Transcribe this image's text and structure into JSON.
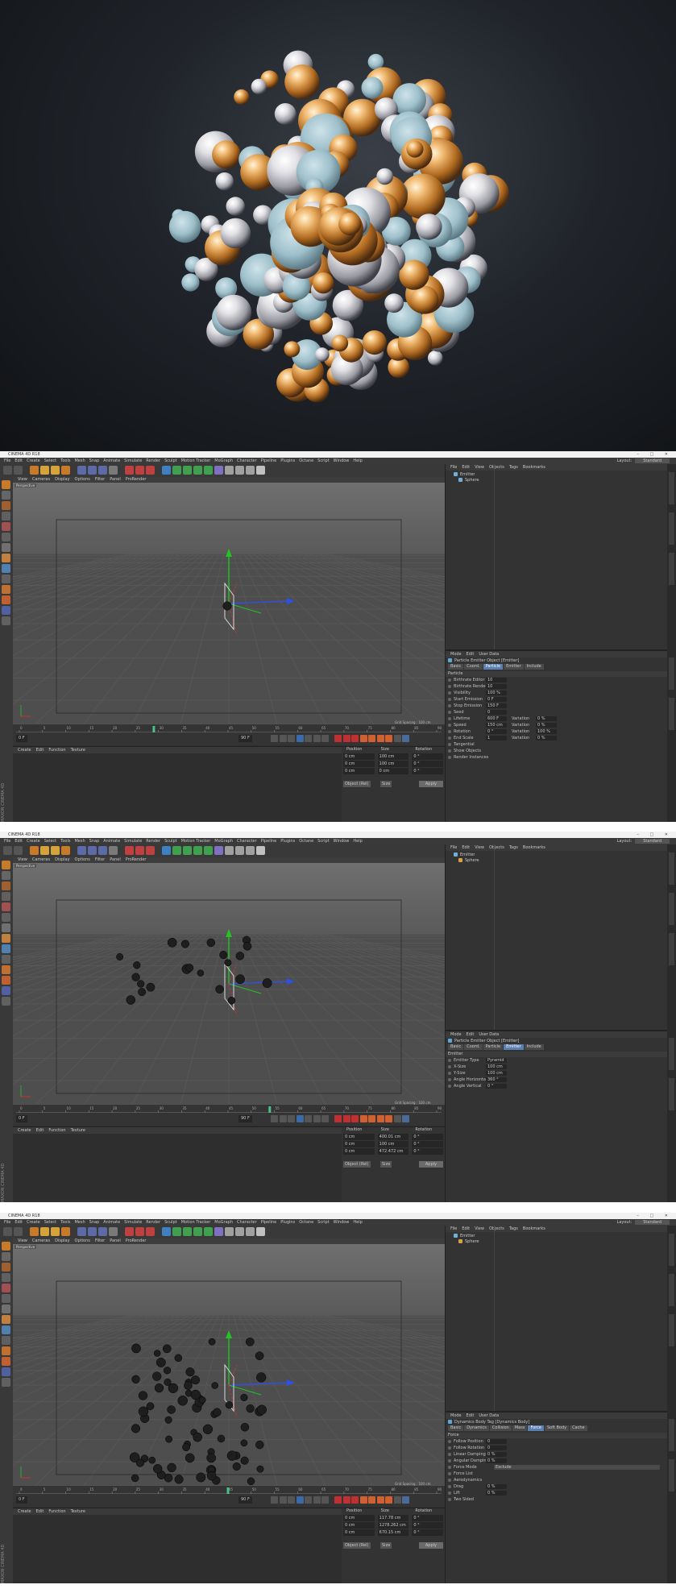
{
  "hero": {
    "alt": ""
  },
  "colors": {
    "accent_blue": "#5a7fb0",
    "axis_y": "#22c322",
    "axis_x": "#e03030",
    "axis_z": "#3050e0",
    "gold": "#e0a050",
    "silver": "#e8e8ea",
    "teal": "#9fc0cc"
  },
  "app": {
    "title": "CINEMA 4D R18",
    "menu": [
      "File",
      "Edit",
      "Create",
      "Select",
      "Tools",
      "Mesh",
      "Snap",
      "Animate",
      "Simulate",
      "Render",
      "Sculpt",
      "Motion Tracker",
      "MoGraph",
      "Character",
      "Pipeline",
      "Plugins",
      "Octane",
      "Script",
      "Window",
      "Help"
    ],
    "layout_label": "Layout:",
    "layout_value": "Standard",
    "viewport_menu": [
      "View",
      "Cameras",
      "Display",
      "Options",
      "Filter",
      "Panel",
      "ProRender"
    ],
    "viewport_label": "Perspective",
    "grid_spacing": "Grid Spacing : 100 cm",
    "material_menu": [
      "Create",
      "Edit",
      "Function",
      "Texture"
    ],
    "object_menu": [
      "File",
      "Edit",
      "View",
      "Objects",
      "Tags",
      "Bookmarks"
    ],
    "attr_menu": [
      "Mode",
      "Edit",
      "User Data"
    ],
    "coord_headers": [
      "Position",
      "Size",
      "Rotation"
    ],
    "coord_mode": "Object (Rel)",
    "coord_size_mode": "Size",
    "apply": "Apply",
    "maxon": "MAXON CINEMA 4D",
    "timeline_ticks": [
      "0",
      "5",
      "10",
      "15",
      "20",
      "25",
      "30",
      "35",
      "40",
      "45",
      "50",
      "55",
      "60",
      "65",
      "70",
      "75",
      "80",
      "85",
      "90"
    ],
    "frame_start": "0 F",
    "frame_end": "90 F"
  },
  "panels": [
    {
      "objects": [
        {
          "name": "Emitter",
          "icon_color": "#6fb0d8"
        },
        {
          "name": "Sphere",
          "icon_color": "#6fb0d8"
        }
      ],
      "attr_title": "Particle Emitter Object [Emitter]",
      "attr_tabs": [
        "Basic",
        "Coord.",
        "Particle",
        "Emitter",
        "Include"
      ],
      "active_tab": "Particle",
      "section": "Particle",
      "params": [
        {
          "label": "Birthrate Editor",
          "value": "10"
        },
        {
          "label": "Birthrate Renderer",
          "value": "10"
        },
        {
          "label": "Visibility",
          "value": "100 %"
        },
        {
          "label": "Start Emission",
          "value": "0 F"
        },
        {
          "label": "Stop Emission",
          "value": "150 F"
        },
        {
          "label": "Seed",
          "value": "0"
        },
        {
          "label": "Lifetime",
          "value": "600 F",
          "label2": "Variation",
          "value2": "0 %"
        },
        {
          "label": "Speed",
          "value": "150 cm",
          "label2": "Variation",
          "value2": "0 %"
        },
        {
          "label": "Rotation",
          "value": "0 °",
          "label2": "Variation",
          "value2": "100 %"
        },
        {
          "label": "End Scale",
          "value": "1",
          "label2": "Variation",
          "value2": "0 %"
        },
        {
          "label": "Tangential",
          "value": ""
        },
        {
          "label": "Show Objects",
          "value": ""
        },
        {
          "label": "Render Instances",
          "value": ""
        }
      ],
      "coords": [
        [
          "0 cm",
          "100 cm",
          "0 °"
        ],
        [
          "0 cm",
          "100 cm",
          "0 °"
        ],
        [
          "0 cm",
          "0 cm",
          "0 °"
        ]
      ],
      "playhead_frame": 29
    },
    {
      "objects": [
        {
          "name": "Emitter",
          "icon_color": "#6fb0d8"
        },
        {
          "name": "Sphere",
          "icon_color": "#d8a040"
        }
      ],
      "attr_title": "Particle Emitter Object [Emitter]",
      "attr_tabs": [
        "Basic",
        "Coord.",
        "Particle",
        "Emitter",
        "Include"
      ],
      "active_tab": "Emitter",
      "section": "Emitter",
      "params": [
        {
          "label": "Emitter Type",
          "value": "Pyramid"
        },
        {
          "label": "X-Size",
          "value": "100 cm"
        },
        {
          "label": "Y-Size",
          "value": "100 cm"
        },
        {
          "label": "Angle Horizontal",
          "value": "360 °"
        },
        {
          "label": "Angle Vertical",
          "value": "0 °"
        }
      ],
      "coords": [
        [
          "0 cm",
          "400.01 cm",
          "0 °"
        ],
        [
          "0 cm",
          "100 cm",
          "0 °"
        ],
        [
          "0 cm",
          "472.472 cm",
          "0 °"
        ]
      ],
      "playhead_frame": 54
    },
    {
      "objects": [
        {
          "name": "Emitter",
          "icon_color": "#6fb0d8"
        },
        {
          "name": "Sphere",
          "icon_color": "#d8a040"
        }
      ],
      "attr_title": "Dynamics Body Tag [Dynamics Body]",
      "attr_tabs": [
        "Basic",
        "Dynamics",
        "Collision",
        "Mass",
        "Force",
        "Soft Body",
        "Cache"
      ],
      "active_tab": "Force",
      "section": "Force",
      "params": [
        {
          "label": "Follow Position",
          "value": "0"
        },
        {
          "label": "Follow Rotation",
          "value": "0"
        },
        {
          "label": "Linear Damping",
          "value": "0 %"
        },
        {
          "label": "Angular Damping",
          "value": "0 %"
        },
        {
          "label": "Force Mode",
          "value": "Exclude",
          "wide": true
        },
        {
          "label": "Force List",
          "value": ""
        },
        {
          "label": "Aerodynamics",
          "value": ""
        },
        {
          "label": "Drag",
          "value": "0 %"
        },
        {
          "label": "Lift",
          "value": "0 %"
        },
        {
          "label": "Two Sided",
          "value": ""
        }
      ],
      "coords": [
        [
          "0 cm",
          "117.78 cm",
          "0 °"
        ],
        [
          "0 cm",
          "1278.262 cm",
          "0 °"
        ],
        [
          "0 cm",
          "670.15 cm",
          "0 °"
        ]
      ],
      "playhead_frame": 45
    }
  ]
}
